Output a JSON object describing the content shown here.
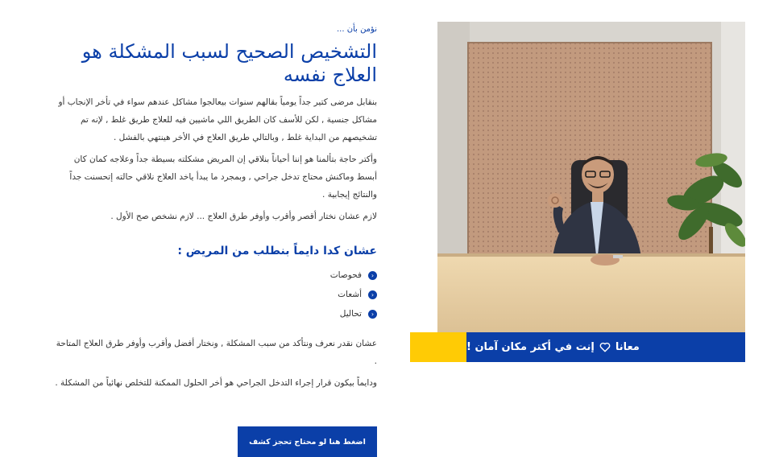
{
  "content": {
    "eyebrow": "نؤمن بأن ...",
    "headline": "التشخيص الصحيح لسبب المشكلة هو العلاج نفسه",
    "paragraph1": "بنقابل مرضى كتير جداً يومياً بقالهم سنوات بيعالجوا مشاكل عندهم سواء في تأخر الإنجاب أو مشاكل جنسية , لكن للأسف كان الطريق اللي ماشيين فيه للعلاج طريق غلط , لإنه تم تشخيصهم من البداية غلط , وبالتالي طريق العلاج في الأخر هينتهي بالفشل .",
    "paragraph2": "وأكتر حاجة بتألمنا هو إننا أحياناً بنلاقي إن المريض مشكلته بسيطة جداً وعلاجه كمان كان أبسط وماكنش محتاج تدخل جراحي , وبمجرد ما يبدأ ياخد العلاج نلاقي حالته إتحسنت جداً والنتائج إيجابية .",
    "paragraph3": "لازم عشان نختار أقصر وأقرب وأوفر طرق العلاج ... لازم نشخص صح الأول .",
    "subheading": "عشان كدا دايماً بنطلب من المريض :",
    "list": [
      "فحوصات",
      "أشعات",
      "تحاليل"
    ],
    "paragraph4": "عشان نقدر نعرف ونتأكد من سبب المشكلة , ونختار أفضل وأقرب وأوفر طرق العلاج المتاحة .",
    "paragraph5": "ودايماً بيكون قرار إجراء التدخل الجراحي هو أخر الحلول الممكنة للتخلص نهائياً من المشكلة ."
  },
  "cta": {
    "label": "اضغط هنا لو محتاج تحجز كشف"
  },
  "banner": {
    "text_strong": "معانا",
    "text_rest": "إنت في أكتر مكان آمان !"
  },
  "icons": {
    "bullet": "chevron-circle-right-icon",
    "banner": "heart-outline-icon"
  },
  "colors": {
    "primary": "#0b3fa8",
    "accent": "#ffcb05",
    "text": "#333333"
  }
}
